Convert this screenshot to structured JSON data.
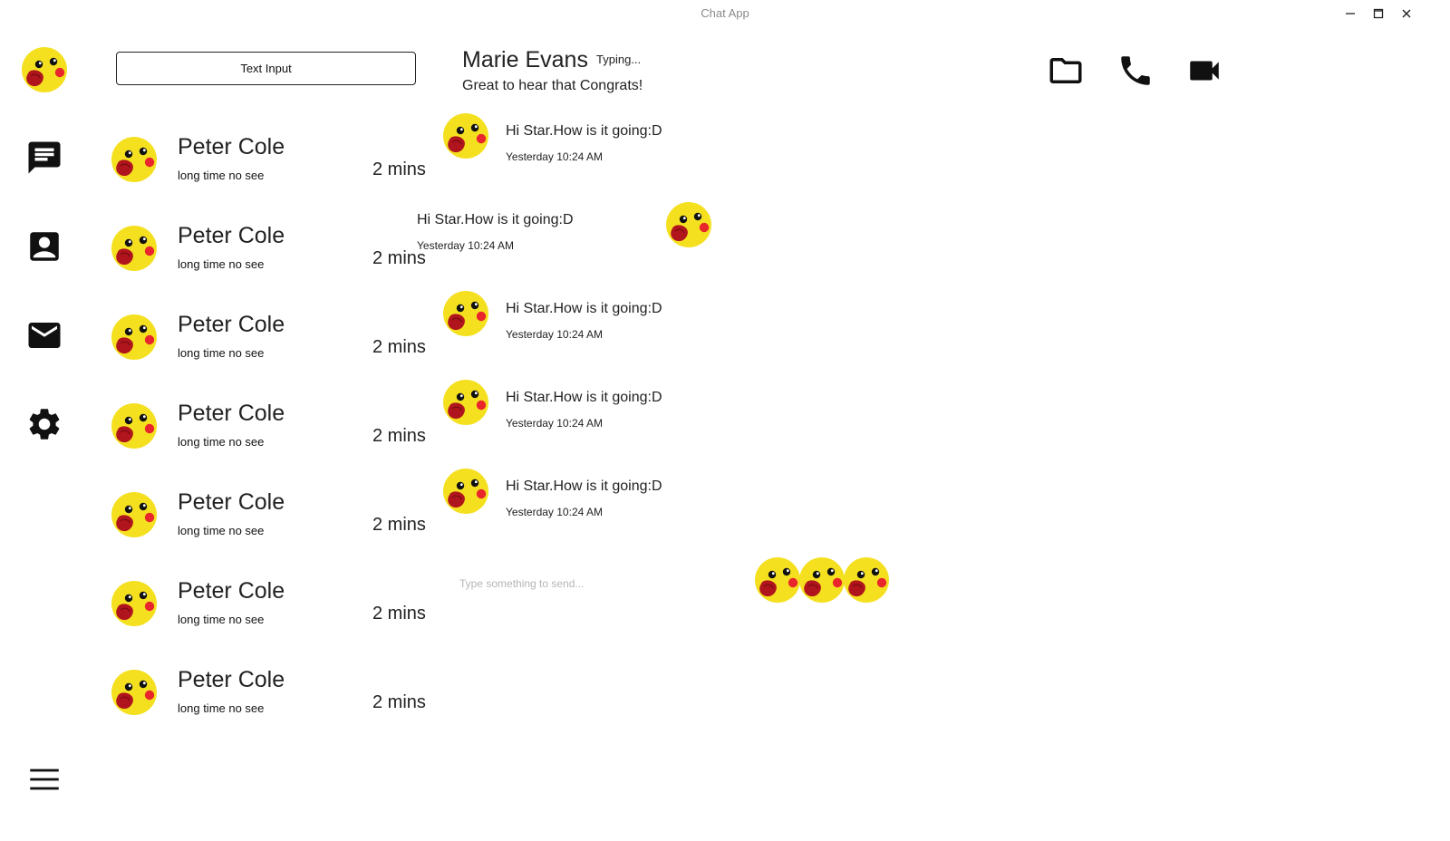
{
  "window": {
    "title": "Chat App"
  },
  "sidebar": {
    "items": [
      {
        "icon": "chat-icon"
      },
      {
        "icon": "contacts-icon"
      },
      {
        "icon": "mail-icon"
      },
      {
        "icon": "settings-icon"
      }
    ],
    "menu_icon": "hamburger-menu-icon"
  },
  "search": {
    "value": "Text Input"
  },
  "contacts": [
    {
      "name": "Peter Cole",
      "preview": "long time no see",
      "time": "2 mins"
    },
    {
      "name": "Peter Cole",
      "preview": "long time no see",
      "time": "2 mins"
    },
    {
      "name": "Peter Cole",
      "preview": "long time no see",
      "time": "2 mins"
    },
    {
      "name": "Peter Cole",
      "preview": "long time no see",
      "time": "2 mins"
    },
    {
      "name": "Peter Cole",
      "preview": "long time no see",
      "time": "2 mins"
    },
    {
      "name": "Peter Cole",
      "preview": "long time no see",
      "time": "2 mins"
    },
    {
      "name": "Peter Cole",
      "preview": "long time no see",
      "time": "2 mins"
    }
  ],
  "chat": {
    "name": "Marie Evans",
    "status": "Typing...",
    "last_message": "Great to hear that Congrats!",
    "header_icons": [
      "folder-icon",
      "phone-icon",
      "video-camera-icon"
    ],
    "messages": [
      {
        "side": "left",
        "text": "Hi Star.How is it going:D",
        "time": "Yesterday 10:24 AM"
      },
      {
        "side": "right",
        "text": "Hi Star.How is it going:D",
        "time": "Yesterday 10:24 AM"
      },
      {
        "side": "left",
        "text": "Hi Star.How is it going:D",
        "time": "Yesterday 10:24 AM"
      },
      {
        "side": "left",
        "text": "Hi Star.How is it going:D",
        "time": "Yesterday 10:24 AM"
      },
      {
        "side": "left",
        "text": "Hi Star.How is it going:D",
        "time": "Yesterday 10:24 AM"
      }
    ]
  },
  "composer": {
    "placeholder": "Type something to send..."
  },
  "colors": {
    "avatar_yellow": "#f5e020",
    "cheek_red": "#e8262b",
    "beak_red": "#b0141c",
    "icon_black": "#111111"
  }
}
